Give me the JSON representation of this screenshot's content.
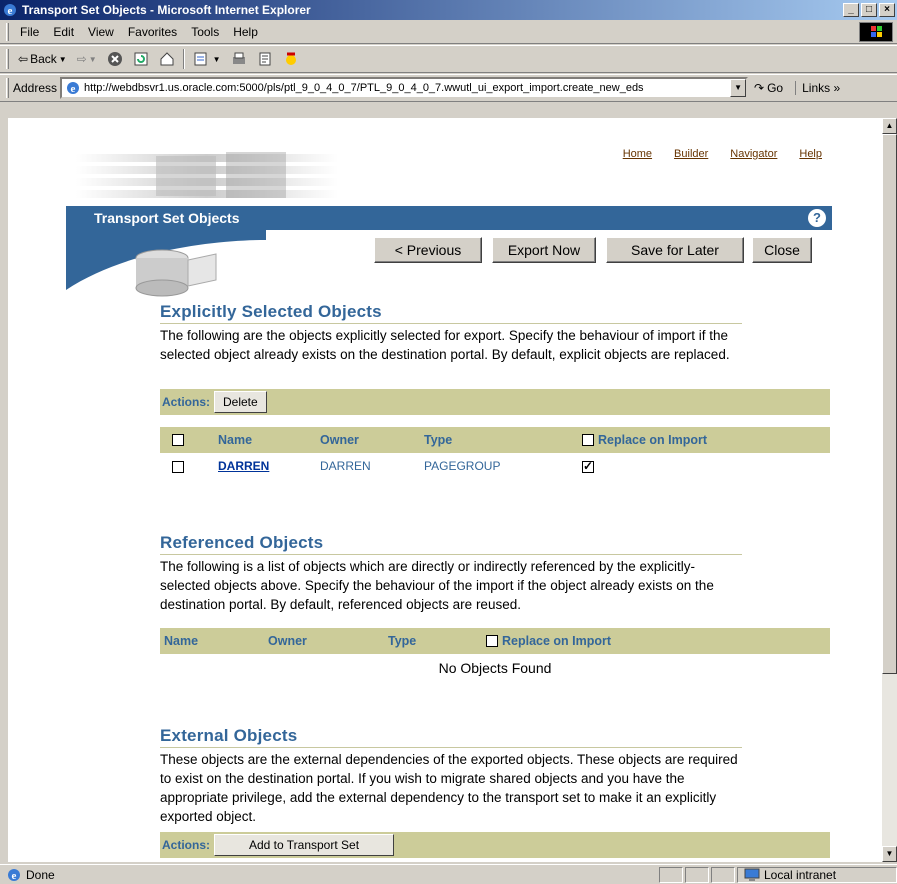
{
  "window": {
    "title": "Transport Set Objects - Microsoft Internet Explorer",
    "controls": [
      "_",
      "□",
      "×"
    ]
  },
  "menu": [
    "File",
    "Edit",
    "View",
    "Favorites",
    "Tools",
    "Help"
  ],
  "toolbar": {
    "back_label": "Back"
  },
  "address": {
    "label": "Address",
    "url": "http://webdbsvr1.us.oracle.com:5000/pls/ptl_9_0_4_0_7/PTL_9_0_4_0_7.wwutl_ui_export_import.create_new_eds",
    "go_label": "Go",
    "links_label": "Links »"
  },
  "status": {
    "text": "Done",
    "zone": "Local intranet"
  },
  "page": {
    "top_links": [
      "Home",
      "Builder",
      "Navigator",
      "Help"
    ],
    "banner_title": "Transport Set Objects",
    "help_glyph": "?",
    "buttons": {
      "previous": "< Previous",
      "export": "Export Now",
      "save": "Save for Later",
      "close": "Close"
    },
    "explicit": {
      "title": "Explicitly Selected Objects",
      "desc": "The following are the objects explicitly selected for export. Specify the behaviour of import if the selected object already exists on the destination portal. By default, explicit objects are replaced.",
      "actions_label": "Actions:",
      "delete_label": "Delete",
      "columns": {
        "name": "Name",
        "owner": "Owner",
        "type": "Type",
        "replace": "Replace on Import"
      },
      "rows": [
        {
          "name": "DARREN",
          "owner": "DARREN",
          "type": "PAGEGROUP",
          "selected": false,
          "replace": true
        }
      ]
    },
    "referenced": {
      "title": "Referenced Objects",
      "desc": "The following is a list of objects which are directly or indirectly referenced by the explicitly-selected objects above. Specify the behaviour of the import if the object already exists on the destination portal. By default, referenced objects are reused.",
      "columns": {
        "name": "Name",
        "owner": "Owner",
        "type": "Type",
        "replace": "Replace on Import"
      },
      "empty": "No Objects Found"
    },
    "external": {
      "title": "External Objects",
      "desc": "These objects are the external dependencies of the exported objects. These objects are required to exist on the destination portal. If you wish to migrate shared objects and you have the appropriate privilege, add the external dependency to the transport set to make it an explicitly exported object.",
      "actions_label": "Actions:",
      "add_label": "Add to Transport Set"
    }
  }
}
